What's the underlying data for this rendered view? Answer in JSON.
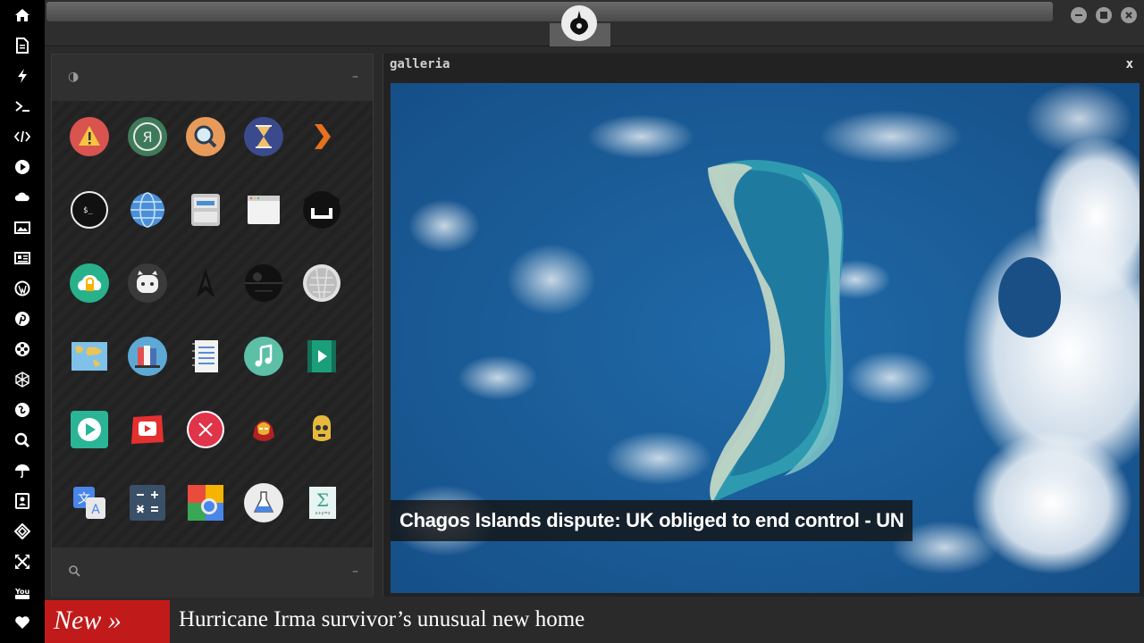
{
  "sidebar": {
    "items": [
      {
        "icon": "home-icon"
      },
      {
        "icon": "document-icon"
      },
      {
        "icon": "bolt-icon"
      },
      {
        "icon": "terminal-icon"
      },
      {
        "icon": "code-icon"
      },
      {
        "icon": "play-circle-icon"
      },
      {
        "icon": "cloud-icon"
      },
      {
        "icon": "image-icon"
      },
      {
        "icon": "newspaper-icon"
      },
      {
        "icon": "wordpress-icon"
      },
      {
        "icon": "pinterest-icon"
      },
      {
        "icon": "film-reel-icon"
      },
      {
        "icon": "polygon-icon"
      },
      {
        "icon": "globe-icon"
      },
      {
        "icon": "search-icon"
      },
      {
        "icon": "umbrella-icon"
      },
      {
        "icon": "contacts-icon"
      },
      {
        "icon": "tag-icon"
      },
      {
        "icon": "expand-icon"
      },
      {
        "icon": "youtube-icon"
      },
      {
        "icon": "heart-icon"
      }
    ]
  },
  "topbar": {
    "logo_icon": "rebel-alliance-icon",
    "window_buttons": [
      "minimize",
      "maximize",
      "close"
    ]
  },
  "launcher": {
    "header_icon": "contrast-icon",
    "header_minus": "–",
    "footer_icon": "search-icon",
    "footer_minus": "–",
    "apps": [
      "warning-app",
      "yandex-app",
      "search-app",
      "hourglass-app",
      "plex-app",
      "terminal-app",
      "globe-app",
      "file-manager-app",
      "browser-window-app",
      "ubuntu-app",
      "cloud-lock-app",
      "github-app",
      "star-trek-app",
      "death-star-app",
      "wikipedia-app",
      "world-map-app",
      "books-app",
      "notes-app",
      "music-app",
      "video-app",
      "media-player-app",
      "youtube-app",
      "close-app",
      "iron-man-app",
      "c3po-app",
      "translate-app",
      "calculator-app",
      "screenshot-app",
      "lab-flask-app",
      "formula-app"
    ]
  },
  "gallery": {
    "title": "galleria",
    "close_label": "x",
    "caption": "Chagos Islands dispute: UK obliged to end control - UN"
  },
  "ticker": {
    "badge": "New »",
    "headline": "Hurricane Irma survivor’s unusual new home"
  },
  "colors": {
    "ticker_badge": "#c01a1a",
    "sidebar": "#000000",
    "ocean": "#1a5c9a"
  }
}
